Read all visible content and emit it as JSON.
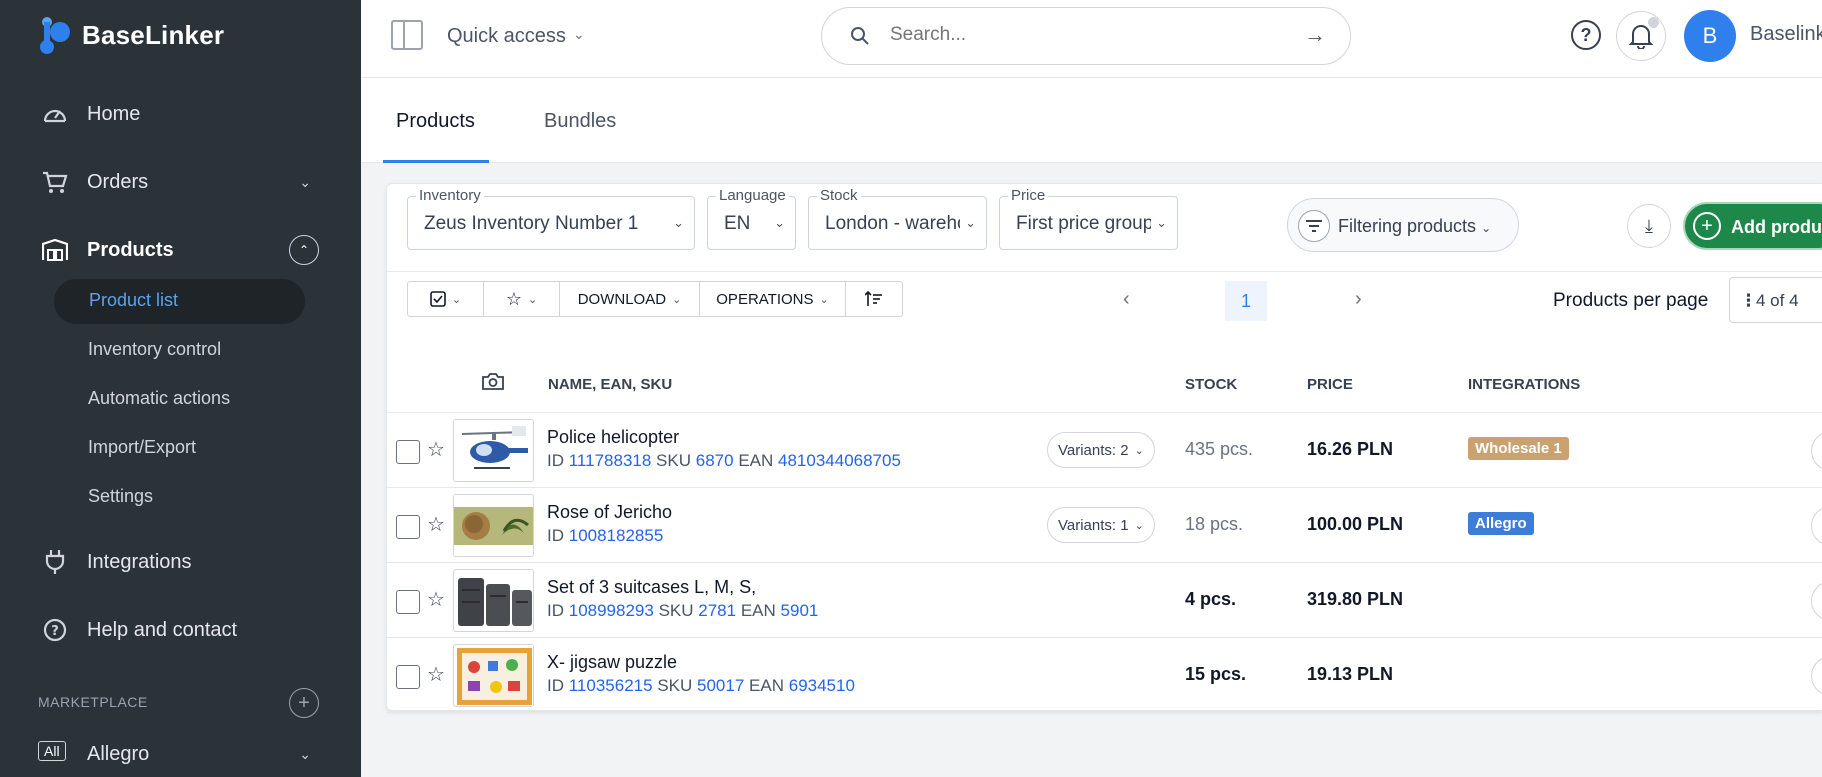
{
  "app": {
    "name": "BaseLinker"
  },
  "colors": {
    "sidebar_bg": "#2b3238",
    "accent": "#2f80ed",
    "add_button": "#1e874a",
    "badge_wholesale": "#c9a26f",
    "badge_allegro": "#3b7dd8"
  },
  "sidebar": {
    "items": [
      {
        "label": "Home",
        "icon": "dashboard-icon"
      },
      {
        "label": "Orders",
        "icon": "cart-icon"
      },
      {
        "label": "Products",
        "icon": "warehouse-icon"
      },
      {
        "label": "Integrations",
        "icon": "plug-icon"
      },
      {
        "label": "Help and contact",
        "icon": "help-icon"
      }
    ],
    "sub_items": [
      "Product list",
      "Inventory control",
      "Automatic actions",
      "Import/Export",
      "Settings"
    ],
    "marketplace_label": "MARKETPLACE",
    "marketplace_badge": "All",
    "marketplace_item": "Allegro"
  },
  "topbar": {
    "quick_access": "Quick access",
    "search_placeholder": "Search...",
    "avatar_letter": "B",
    "user_name": "Baselinker"
  },
  "tabs": [
    "Products",
    "Bundles"
  ],
  "filters": {
    "inventory": {
      "label": "Inventory",
      "value": "Zeus Inventory Number 1"
    },
    "language": {
      "label": "Language",
      "value": "EN"
    },
    "stock": {
      "label": "Stock",
      "value": "London - warehouse"
    },
    "price": {
      "label": "Price",
      "value": "First price group"
    },
    "filtering_label": "Filtering products",
    "add_label": "Add product"
  },
  "toolbar": {
    "download": "DOWNLOAD",
    "operations": "OPERATIONS"
  },
  "pagination": {
    "page": "1",
    "per_page_label": "Products per page",
    "per_page_value": "4 of 4"
  },
  "table": {
    "headers": {
      "name": "NAME, EAN, SKU",
      "stock": "STOCK",
      "price": "PRICE",
      "integrations": "INTEGRATIONS"
    },
    "rows": [
      {
        "name": "Police helicopter",
        "id_label": "ID",
        "id": "111788318",
        "sku_label": "SKU",
        "sku": "6870",
        "ean_label": "EAN",
        "ean": "4810344068705",
        "variants": "Variants: 2",
        "stock": "435 pcs.",
        "price": "16.26 PLN",
        "integration": "Wholesale 1"
      },
      {
        "name": "Rose of Jericho",
        "id_label": "ID",
        "id": "1008182855",
        "variants": "Variants: 1",
        "stock": "18 pcs.",
        "price": "100.00 PLN",
        "integration": "Allegro"
      },
      {
        "name": "Set of 3 suitcases L, M, S,",
        "id_label": "ID",
        "id": "108998293",
        "sku_label": "SKU",
        "sku": "2781",
        "ean_label": "EAN",
        "ean": "5901",
        "stock": "4 pcs.",
        "price": "319.80 PLN"
      },
      {
        "name": "X- jigsaw puzzle",
        "id_label": "ID",
        "id": "110356215",
        "sku_label": "SKU",
        "sku": "50017",
        "ean_label": "EAN",
        "ean": "6934510",
        "stock": "15 pcs.",
        "price": "19.13 PLN"
      }
    ]
  }
}
